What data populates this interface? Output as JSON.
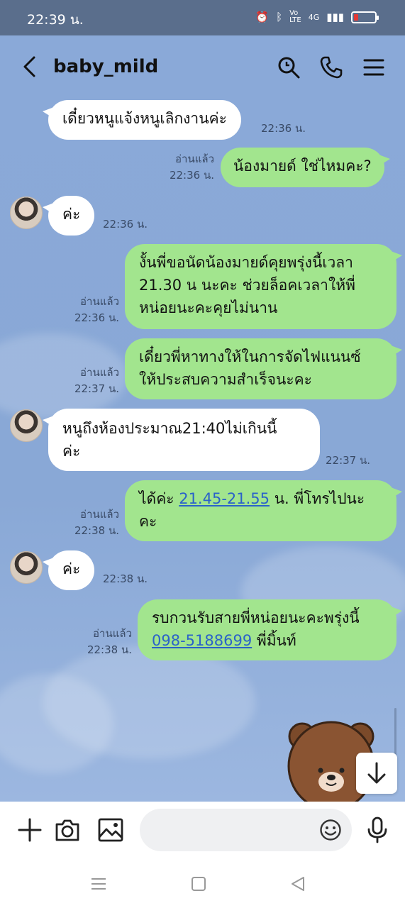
{
  "status": {
    "time": "22:39 น.",
    "network": "4G"
  },
  "header": {
    "contact_name": "baby_mild"
  },
  "messages": [
    {
      "dir": "in",
      "avatar": false,
      "lines": [
        "เดี๋ยวหนูแจ้งหนูเลิกงานค่ะ"
      ],
      "time": "22:36 น."
    },
    {
      "dir": "out",
      "lines": [
        "น้องมายด์ ใช่ไหมคะ?"
      ],
      "read": "อ่านแล้ว",
      "time": "22:36 น."
    },
    {
      "dir": "in",
      "avatar": true,
      "lines": [
        "ค่ะ"
      ],
      "time": "22:36 น."
    },
    {
      "dir": "out",
      "lines": [
        "งั้นพี่ขอนัดน้องมายด์คุยพรุ่งนี้เวลา",
        "21.30 น นะคะ ช่วยล็อคเวลาให้พี่",
        "หน่อยนะคะคุยไม่นาน"
      ],
      "read": "อ่านแล้ว",
      "time": "22:36 น."
    },
    {
      "dir": "out",
      "lines": [
        "เดี๋ยวพี่หาทางให้ในการจัดไฟแนนซ์",
        "ให้ประสบความสำเร็จนะคะ"
      ],
      "read": "อ่านแล้ว",
      "time": "22:37 น."
    },
    {
      "dir": "in",
      "avatar": true,
      "lines": [
        "หนูถึงห้องประมาณ21:40ไม่เกินนี้",
        "ค่ะ"
      ],
      "time": "22:37 น."
    },
    {
      "dir": "out",
      "lines": [
        "ได้ค่ะ ",
        "21.45-21.55",
        " น. พี่โทรไปนะ",
        "คะ"
      ],
      "read": "อ่านแล้ว",
      "time": "22:38 น."
    },
    {
      "dir": "in",
      "avatar": true,
      "lines": [
        "ค่ะ"
      ],
      "time": "22:38 น."
    },
    {
      "dir": "out",
      "lines": [
        "รบกวนรับสายพี่หน่อยนะคะพรุ่งนี้",
        "098-5188699",
        " พี่มิ้นท์"
      ],
      "read": "อ่านแล้ว",
      "time": "22:38 น."
    }
  ],
  "input": {
    "placeholder": ""
  },
  "colors": {
    "chat_bg": "#8aa9d8",
    "outgoing_bubble": "#a2e58e",
    "incoming_bubble": "#ffffff",
    "link": "#2a62c9"
  }
}
